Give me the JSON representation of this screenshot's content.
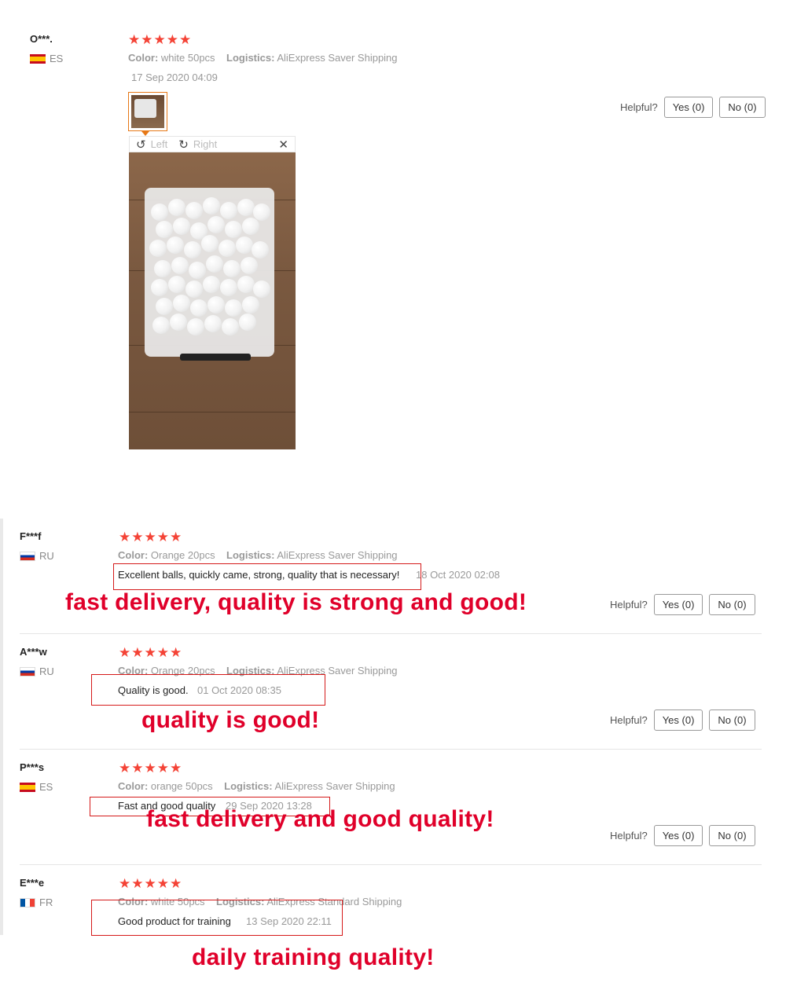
{
  "reviews": [
    {
      "user": "O***.",
      "country": "ES",
      "rating": 5,
      "stars": "★★★★★",
      "color_label": "Color:",
      "color_value": "white 50pcs",
      "logistics_label": "Logistics:",
      "logistics_value": "AliExpress Saver Shipping",
      "date": "17 Sep 2020 04:09",
      "helpful_label": "Helpful?",
      "yes_label": "Yes (0)",
      "no_label": "No (0)",
      "viewer": {
        "left_label": "Left",
        "right_label": "Right",
        "left_icon": "rotate-left-icon",
        "right_icon": "rotate-right-icon",
        "close_icon": "close-icon"
      }
    },
    {
      "user": "F***f",
      "country": "RU",
      "rating": 5,
      "stars": "★★★★★",
      "color_label": "Color:",
      "color_value": "Orange 20pcs",
      "logistics_label": "Logistics:",
      "logistics_value": "AliExpress Saver Shipping",
      "text": "Excellent balls, quickly came, strong, quality that is necessary!",
      "date": "18 Oct 2020 02:08",
      "annotation": "fast delivery, quality is strong and good!",
      "helpful_label": "Helpful?",
      "yes_label": "Yes (0)",
      "no_label": "No (0)"
    },
    {
      "user": "A***w",
      "country": "RU",
      "rating": 5,
      "stars": "★★★★★",
      "color_label": "Color:",
      "color_value": "Orange 20pcs",
      "logistics_label": "Logistics:",
      "logistics_value": "AliExpress Saver Shipping",
      "text": "Quality is good.",
      "date": "01 Oct 2020 08:35",
      "annotation": "quality is good!",
      "helpful_label": "Helpful?",
      "yes_label": "Yes (0)",
      "no_label": "No (0)"
    },
    {
      "user": "P***s",
      "country": "ES",
      "rating": 5,
      "stars": "★★★★★",
      "color_label": "Color:",
      "color_value": "orange 50pcs",
      "logistics_label": "Logistics:",
      "logistics_value": "AliExpress Saver Shipping",
      "text": "Fast and good quality",
      "date": "29 Sep 2020 13:28",
      "annotation": "fast delivery and good quality!",
      "helpful_label": "Helpful?",
      "yes_label": "Yes (0)",
      "no_label": "No (0)"
    },
    {
      "user": "E***e",
      "country": "FR",
      "rating": 5,
      "stars": "★★★★★",
      "color_label": "Color:",
      "color_value": "white 50pcs",
      "logistics_label": "Logistics:",
      "logistics_value": "AliExpress Standard Shipping",
      "text": "Good product for training",
      "date": "13 Sep 2020 22:11",
      "annotation": "daily training quality!"
    }
  ],
  "colors": {
    "star": "#f44336",
    "annotation": "#e0002a",
    "annotation_box": "#d51a1a",
    "thumb_border": "#e67817"
  }
}
